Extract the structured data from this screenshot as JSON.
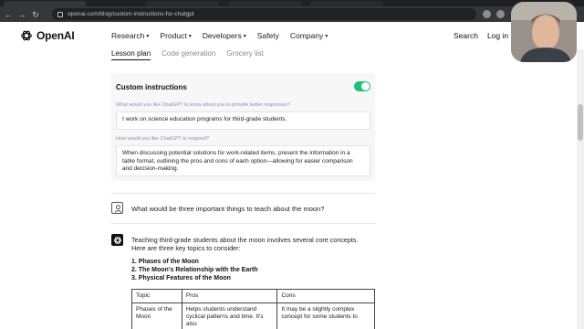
{
  "browser": {
    "url": "openai.com/blog/custom-instructions-for-chatgpt"
  },
  "header": {
    "brand": "OpenAI",
    "nav": [
      {
        "label": "Research",
        "chevron": "chevron-down-icon"
      },
      {
        "label": "Product",
        "chevron": "chevron-down-icon"
      },
      {
        "label": "Developers",
        "chevron": "chevron-down-icon"
      },
      {
        "label": "Safety"
      },
      {
        "label": "Company",
        "chevron": "chevron-down-icon"
      }
    ],
    "search_label": "Search",
    "login_label": "Log in ↗"
  },
  "tabs": [
    "Lesson plan",
    "Code generation",
    "Grocery list"
  ],
  "custom_instructions": {
    "title": "Custom instructions",
    "toggle_on": true,
    "q1": "What would you like ChatGPT to know about you to provide better responses?",
    "a1": "I work on science education programs for third-grade students.",
    "q2": "How would you like ChatGPT to respond?",
    "a2": "When discussing potential solutions for work-related items, present the information in a table format, outlining the pros and cons of each option—allowing for easier comparison and decision-making."
  },
  "conversation": {
    "user_message": "What would be three important things to teach about the moon?",
    "assistant_intro": "Teaching third-grade students about the moon involves several core concepts. Here are three key topics to consider:",
    "topics": [
      "1. Phases of the Moon",
      "2. The Moon's Relationship with the Earth",
      "3. Physical Features of the Moon"
    ],
    "table": {
      "headers": [
        "Topic",
        "Pros",
        "Cons"
      ],
      "row": {
        "topic": "Phases of the Moon",
        "pros": "Helps students understand cyclical patterns and time. It's also",
        "cons": "It may be a slightly complex concept for some students to"
      }
    }
  },
  "colors": {
    "toggle": "#19c37d",
    "browser_chrome": "#35363a"
  }
}
